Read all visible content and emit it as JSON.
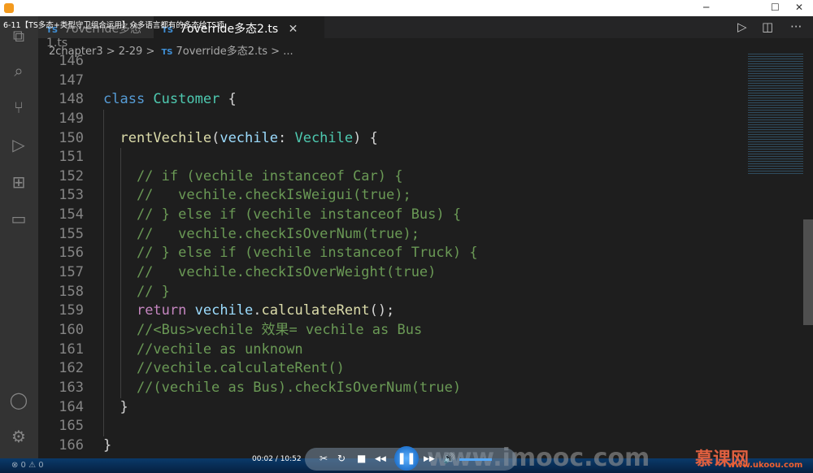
{
  "window": {
    "title": "6-11【TS多态+类型守卫组合运用】众多语言都有的多态给TS项",
    "minimize": "─",
    "maximize": "☐",
    "close": "✕"
  },
  "tabs": [
    {
      "label": "7override多态1.ts",
      "icon": "TS"
    },
    {
      "label": "7override多态2.ts",
      "icon": "TS",
      "close": "✕"
    }
  ],
  "tab_actions": {
    "run": "▷",
    "split": "◫",
    "more": "···"
  },
  "breadcrumb": {
    "items": [
      "2chapter3",
      "2-29",
      "7override多态2.ts",
      "..."
    ],
    "sep": ">",
    "icon": "TS"
  },
  "editor": {
    "lines": [
      {
        "n": "146",
        "indent": 0,
        "t": []
      },
      {
        "n": "147",
        "indent": 0,
        "t": []
      },
      {
        "n": "148",
        "indent": 0,
        "t": [
          [
            "class ",
            "k"
          ],
          [
            "Customer",
            "c"
          ],
          [
            " {",
            "p"
          ]
        ]
      },
      {
        "n": "149",
        "indent": 1,
        "t": []
      },
      {
        "n": "150",
        "indent": 1,
        "t": [
          [
            "  ",
            "p"
          ],
          [
            "rentVechile",
            "f"
          ],
          [
            "(",
            "p"
          ],
          [
            "vechile",
            "v"
          ],
          [
            ": ",
            "p"
          ],
          [
            "Vechile",
            "c"
          ],
          [
            ") {",
            "p"
          ]
        ]
      },
      {
        "n": "151",
        "indent": 2,
        "t": []
      },
      {
        "n": "152",
        "indent": 2,
        "t": [
          [
            "    // if (vechile instanceof Car) {",
            "cm"
          ]
        ]
      },
      {
        "n": "153",
        "indent": 2,
        "t": [
          [
            "    //   vechile.checkIsWeigui(true);",
            "cm"
          ]
        ]
      },
      {
        "n": "154",
        "indent": 2,
        "t": [
          [
            "    // } else if (vechile instanceof Bus) {",
            "cm"
          ]
        ]
      },
      {
        "n": "155",
        "indent": 2,
        "t": [
          [
            "    //   vechile.checkIsOverNum(true);",
            "cm"
          ]
        ]
      },
      {
        "n": "156",
        "indent": 2,
        "t": [
          [
            "    // } else if (vechile instanceof Truck) {",
            "cm"
          ]
        ]
      },
      {
        "n": "157",
        "indent": 2,
        "t": [
          [
            "    //   vechile.checkIsOverWeight(true)",
            "cm"
          ]
        ]
      },
      {
        "n": "158",
        "indent": 2,
        "t": [
          [
            "    // }",
            "cm"
          ]
        ]
      },
      {
        "n": "159",
        "indent": 2,
        "t": [
          [
            "    ",
            "p"
          ],
          [
            "return ",
            "r"
          ],
          [
            "vechile",
            "v"
          ],
          [
            ".",
            "p"
          ],
          [
            "calculateRent",
            "f"
          ],
          [
            "();",
            "p"
          ]
        ]
      },
      {
        "n": "160",
        "indent": 2,
        "t": [
          [
            "    //<Bus>vechile 效果= vechile as Bus",
            "cm"
          ]
        ]
      },
      {
        "n": "161",
        "indent": 2,
        "t": [
          [
            "    //vechile as unknown",
            "cm"
          ]
        ]
      },
      {
        "n": "162",
        "indent": 2,
        "t": [
          [
            "    //vechile.calculateRent()",
            "cm"
          ]
        ]
      },
      {
        "n": "163",
        "indent": 2,
        "t": [
          [
            "    //(vechile as Bus).checkIsOverNum(true)",
            "cm"
          ]
        ]
      },
      {
        "n": "164",
        "indent": 1,
        "t": [
          [
            "  }",
            "p"
          ]
        ]
      },
      {
        "n": "165",
        "indent": 1,
        "t": []
      },
      {
        "n": "166",
        "indent": 0,
        "t": [
          [
            "}",
            "p"
          ]
        ]
      }
    ]
  },
  "status": {
    "problems": "⊗ 0 ⚠ 0"
  },
  "player": {
    "time": "00:02 / 10:52",
    "buttons": [
      "✂",
      "↻",
      "■",
      "◀◀",
      "▶▶",
      "🔊"
    ],
    "pause": "❚❚"
  },
  "watermark": {
    "text": "www.imooc.com",
    "logo": "慕课网",
    "logo_url": "www.ukoou.com"
  }
}
